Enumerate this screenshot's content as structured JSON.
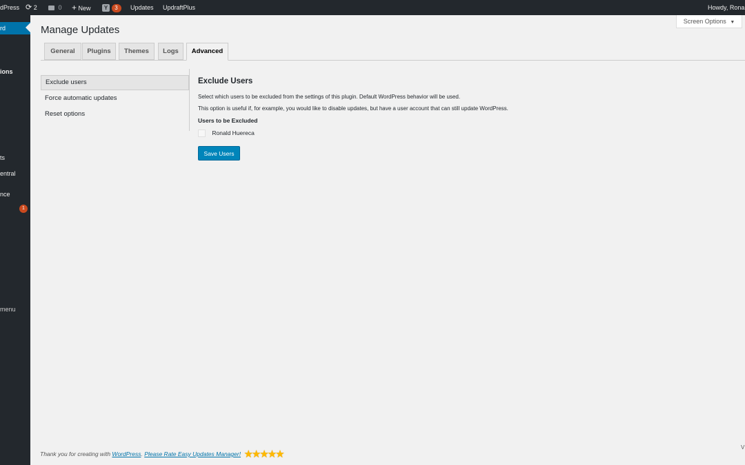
{
  "admin_bar": {
    "site_name": "dPress",
    "updates_count": "2",
    "comments_count": "0",
    "new_label": "New",
    "yoast_count": "3",
    "updates_label": "Updates",
    "updraft_label": "UpdraftPlus",
    "howdy": "Howdy, Ronal"
  },
  "sidebar": {
    "items": [
      {
        "label": "rd"
      },
      {
        "label": "ions"
      },
      {
        "label": "ts"
      },
      {
        "label": "entral"
      },
      {
        "label": "nce"
      },
      {
        "label": "1"
      },
      {
        "label": "menu"
      }
    ]
  },
  "screen_options": {
    "label": "Screen Options"
  },
  "page": {
    "title": "Manage Updates"
  },
  "tabs": [
    {
      "label": "General"
    },
    {
      "label": "Plugins"
    },
    {
      "label": "Themes"
    },
    {
      "label": "Logs"
    },
    {
      "label": "Advanced"
    }
  ],
  "subnav": [
    {
      "label": "Exclude users"
    },
    {
      "label": "Force automatic updates"
    },
    {
      "label": "Reset options"
    }
  ],
  "content": {
    "title": "Exclude Users",
    "desc1": "Select which users to be excluded from the settings of this plugin. Default WordPress behavior will be used.",
    "desc2": "This option is useful if, for example, you would like to disable updates, but have a user account that can still update WordPress.",
    "users_label": "Users to be Excluded",
    "user_name": "Ronald Huereca",
    "save_label": "Save Users"
  },
  "footer": {
    "text": "Thank you for creating with ",
    "wp_link": "WordPress",
    "sep": ". ",
    "rate_link": "Please Rate Easy Updates Manager!",
    "stars": "★★★★★",
    "version_peek": "V"
  },
  "colors": {
    "accent": "#0073aa",
    "button": "#0085ba",
    "badge": "#ca4a1f",
    "star": "#ffb900"
  }
}
